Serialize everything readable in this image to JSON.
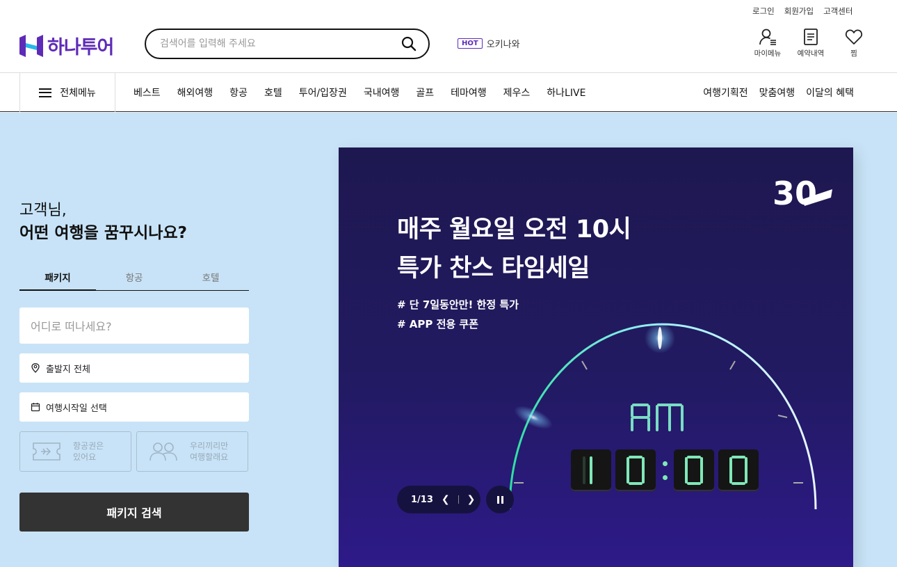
{
  "util_links": [
    "로그인",
    "회원가입",
    "고객센터"
  ],
  "logo": {
    "text": "하나투어",
    "icon": "hana-logo-icon"
  },
  "search": {
    "placeholder": "검색어를 입력해 주세요",
    "icon": "search-icon"
  },
  "hot": {
    "badge": "HOT",
    "keyword": "오키나와"
  },
  "quick": [
    {
      "label": "마이메뉴",
      "icon": "user-menu-icon"
    },
    {
      "label": "예약내역",
      "icon": "document-icon"
    },
    {
      "label": "찜",
      "icon": "heart-icon"
    }
  ],
  "gnb": {
    "all_menu": "전체메뉴",
    "items": [
      "베스트",
      "해외여행",
      "항공",
      "호텔",
      "투어/입장권",
      "국내여행",
      "골프",
      "테마여행",
      "제우스",
      "하나LIVE"
    ],
    "right_items": [
      "여행기획전",
      "맞춤여행",
      "이달의 혜택"
    ]
  },
  "greeting": {
    "line1": "고객님,",
    "line2": "어떤 여행을 꿈꾸시나요?"
  },
  "search_tabs": [
    {
      "label": "패키지",
      "active": true
    },
    {
      "label": "항공",
      "active": false
    },
    {
      "label": "호텔",
      "active": false
    }
  ],
  "form": {
    "destination_placeholder": "어디로 떠나세요?",
    "departure": "출발지 전체",
    "date": "여행시작일 선택",
    "option1": {
      "line1": "항공권은",
      "line2": "있어요",
      "icon": "ticket-icon"
    },
    "option2": {
      "line1": "우리끼리만",
      "line2": "여행할래요",
      "icon": "group-icon"
    },
    "submit": "패키지 검색"
  },
  "banner": {
    "title_line1": "매주 월요일 오전 10시",
    "title_line2": "특가 찬스 타임세일",
    "sub_line1": "# 단 7일동안만! 한정 특가",
    "sub_line2": "# APP 전용 쿠폰",
    "badge": "30",
    "clock": {
      "ampm": "AM",
      "hour": "10",
      "minute": "00"
    },
    "pager": "1/13"
  },
  "colors": {
    "brand": "#5e2bb8",
    "main_bg": "#c8e3f7",
    "banner_bg": "#221a62",
    "clock_digit": "#7fe8b8"
  }
}
